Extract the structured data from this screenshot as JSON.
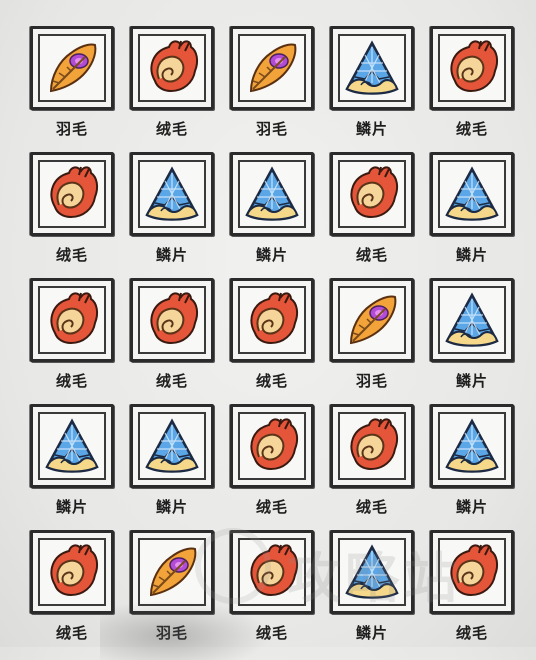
{
  "items": [
    {
      "type": "feather",
      "label": "羽毛"
    },
    {
      "type": "fluff",
      "label": "绒毛"
    },
    {
      "type": "feather",
      "label": "羽毛"
    },
    {
      "type": "scale",
      "label": "鳞片"
    },
    {
      "type": "fluff",
      "label": "绒毛"
    },
    {
      "type": "fluff",
      "label": "绒毛"
    },
    {
      "type": "scale",
      "label": "鳞片"
    },
    {
      "type": "scale",
      "label": "鳞片"
    },
    {
      "type": "fluff",
      "label": "绒毛"
    },
    {
      "type": "scale",
      "label": "鳞片"
    },
    {
      "type": "fluff",
      "label": "绒毛"
    },
    {
      "type": "fluff",
      "label": "绒毛"
    },
    {
      "type": "fluff",
      "label": "绒毛"
    },
    {
      "type": "feather",
      "label": "羽毛"
    },
    {
      "type": "scale",
      "label": "鳞片"
    },
    {
      "type": "scale",
      "label": "鳞片"
    },
    {
      "type": "scale",
      "label": "鳞片"
    },
    {
      "type": "fluff",
      "label": "绒毛"
    },
    {
      "type": "fluff",
      "label": "绒毛"
    },
    {
      "type": "scale",
      "label": "鳞片"
    },
    {
      "type": "fluff",
      "label": "绒毛"
    },
    {
      "type": "feather",
      "label": "羽毛"
    },
    {
      "type": "fluff",
      "label": "绒毛"
    },
    {
      "type": "scale",
      "label": "鳞片"
    },
    {
      "type": "fluff",
      "label": "绒毛"
    }
  ],
  "colors": {
    "fluff_outer": "#e5553a",
    "fluff_inner": "#f6d59a",
    "feather_body": "#f2a33a",
    "feather_tip": "#b24bd6",
    "scale_blue": "#5aa6e6",
    "scale_cream": "#f5d88a"
  }
}
